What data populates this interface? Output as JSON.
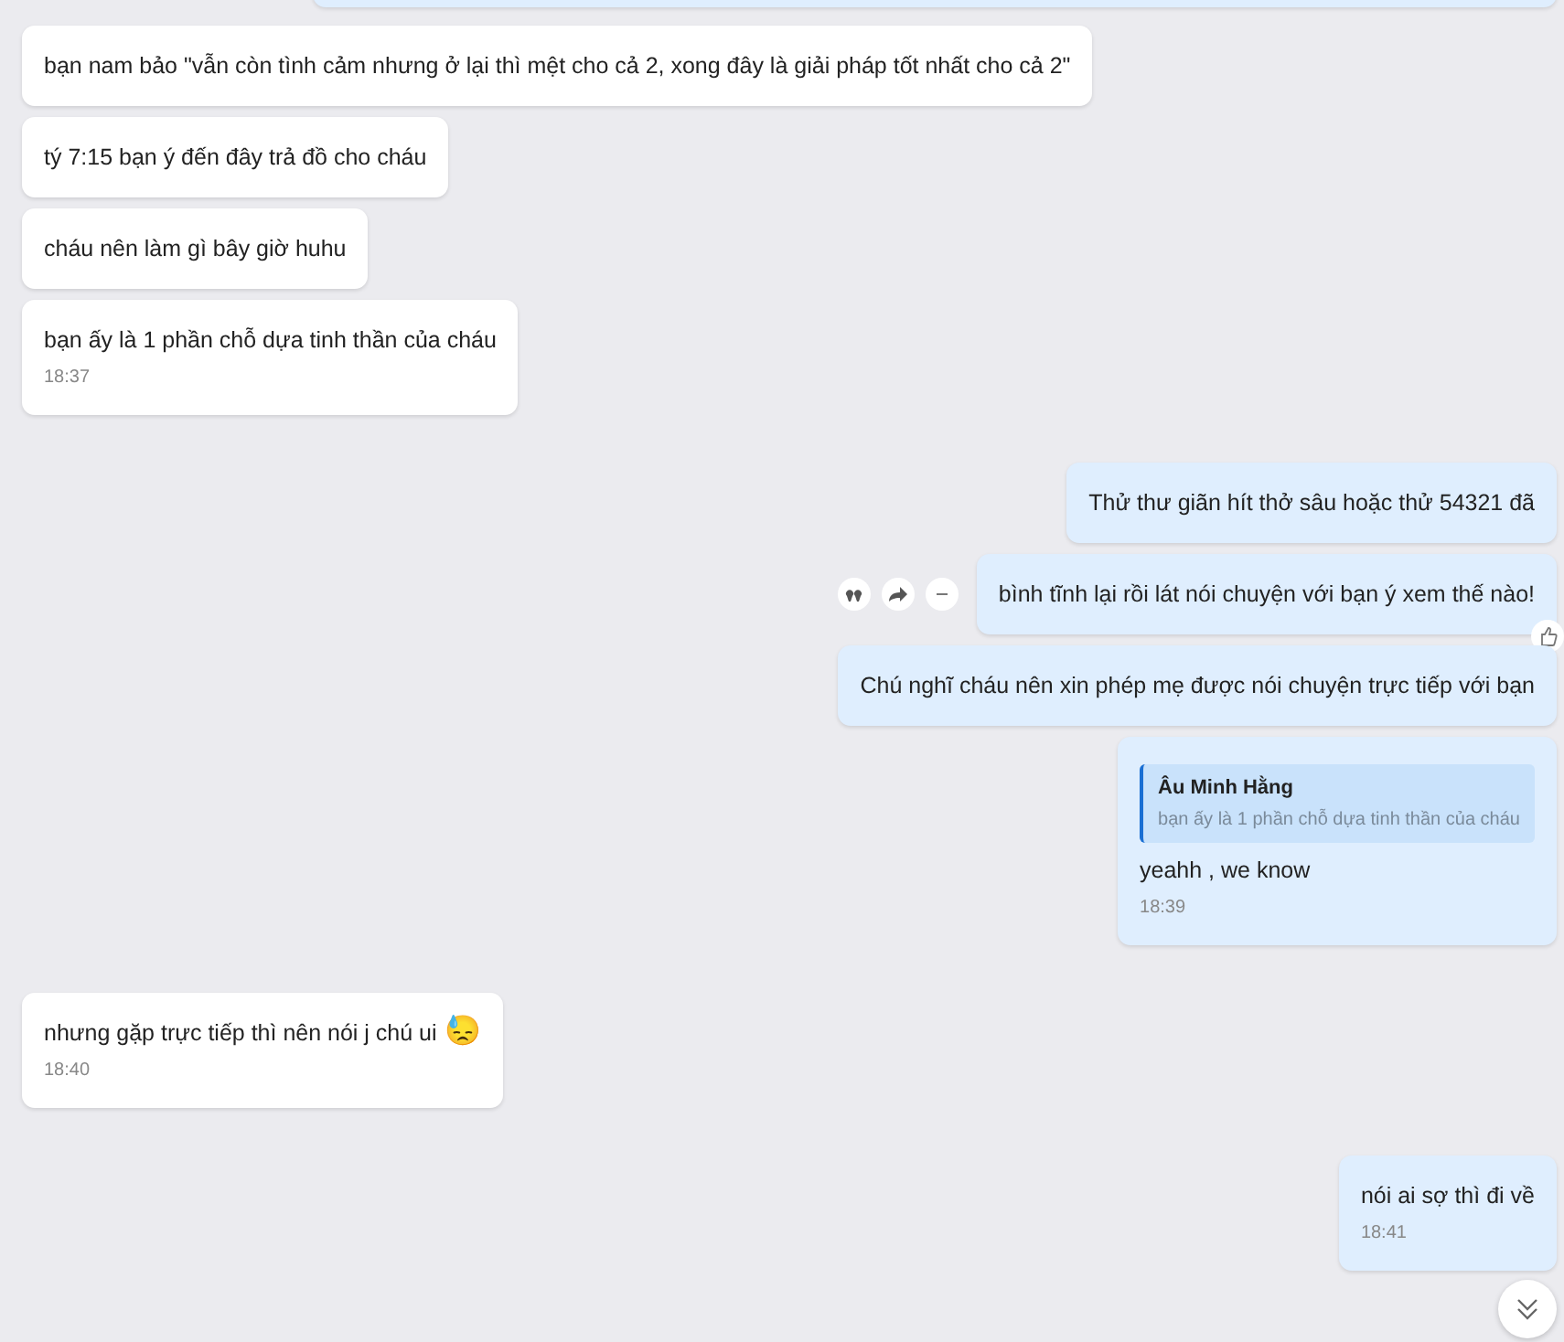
{
  "messages": [
    {
      "outgoing": true,
      "kind": "clipped"
    },
    {
      "outgoing": false,
      "kind": "text",
      "text": "bạn nam bảo \"vẫn còn tình cảm nhưng ở lại thì mệt cho cả 2, xong đây là giải pháp tốt nhất cho cả 2\""
    },
    {
      "outgoing": false,
      "kind": "text",
      "text": "tý 7:15 bạn ý đến đây trả đồ cho cháu"
    },
    {
      "outgoing": false,
      "kind": "text",
      "text": "cháu nên làm gì bây giờ huhu"
    },
    {
      "outgoing": false,
      "kind": "text",
      "text": "bạn ấy là 1 phần chỗ dựa tinh thần của cháu",
      "time": "18:37"
    },
    {
      "outgoing": true,
      "kind": "text",
      "text": "Thử thư giãn hít thở sâu hoặc thử 54321 đã"
    },
    {
      "outgoing": true,
      "kind": "text",
      "text": "bình tĩnh lại rồi lát nói chuyện với bạn ý xem thế nào!",
      "hovered": true
    },
    {
      "outgoing": true,
      "kind": "text",
      "text": "Chú nghĩ cháu nên xin phép mẹ được nói chuyện trực tiếp với bạn"
    },
    {
      "outgoing": true,
      "kind": "reply",
      "quote_author": "Âu Minh Hằng",
      "quote_text": "bạn ấy là 1 phần chỗ dựa tinh thần của cháu",
      "text": "yeahh , we know",
      "time": "18:39"
    },
    {
      "outgoing": false,
      "kind": "text",
      "text": "nhưng gặp trực tiếp thì nên nói j chú ui",
      "emoji": "😓",
      "time": "18:40"
    },
    {
      "outgoing": true,
      "kind": "text",
      "text": "nói ai sợ thì đi về",
      "time": "18:41"
    }
  ]
}
